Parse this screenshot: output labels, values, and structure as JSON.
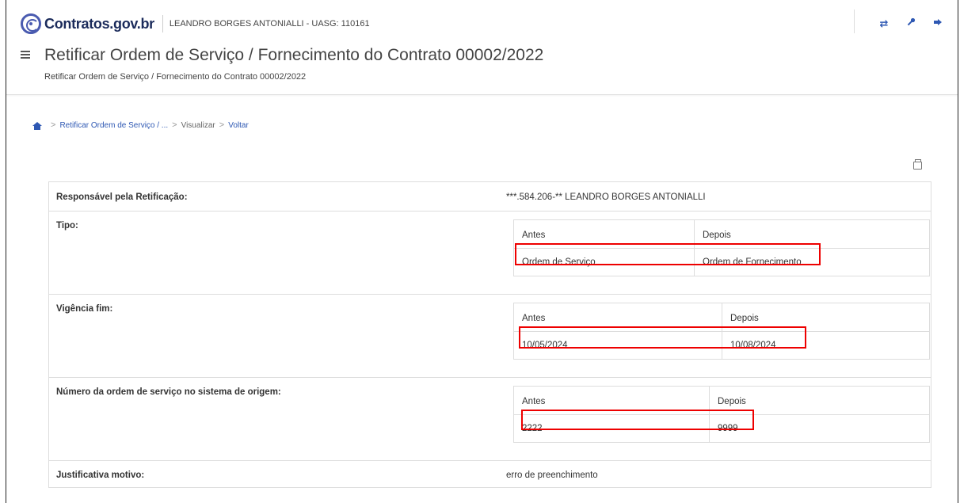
{
  "header": {
    "app_name": "Contratos.gov.br",
    "user_info": "LEANDRO BORGES ANTONIALLI - UASG: 110161",
    "icons": [
      "swap-icon",
      "key-icon",
      "logout-icon"
    ],
    "title": "Retificar Ordem de Serviço / Fornecimento do Contrato 00002/2022",
    "subtitle": "Retificar Ordem de Serviço / Fornecimento do Contrato 00002/2022"
  },
  "breadcrumb": {
    "items": [
      "Retificar Ordem de Serviço / ...",
      "Visualizar",
      "Voltar"
    ]
  },
  "details": {
    "responsavel": {
      "label": "Responsável pela Retificação:",
      "value": "***.584.206-** LEANDRO BORGES ANTONIALLI"
    },
    "tipo": {
      "label": "Tipo:",
      "antes_header": "Antes",
      "depois_header": "Depois",
      "antes": "Ordem de Serviço",
      "depois": "Ordem de Fornecimento"
    },
    "vigencia": {
      "label": "Vigência fim:",
      "antes_header": "Antes",
      "depois_header": "Depois",
      "antes": "10/05/2024",
      "depois": "10/08/2024"
    },
    "numero": {
      "label": "Número da ordem de serviço no sistema de origem:",
      "antes_header": "Antes",
      "depois_header": "Depois",
      "antes": "2222",
      "depois": "9999"
    },
    "justificativa": {
      "label": "Justificativa motivo:",
      "value": "erro de preenchimento"
    }
  },
  "colors": {
    "brand": "#1b2b5b",
    "link": "#2e58b3",
    "highlight": "#e00000"
  }
}
